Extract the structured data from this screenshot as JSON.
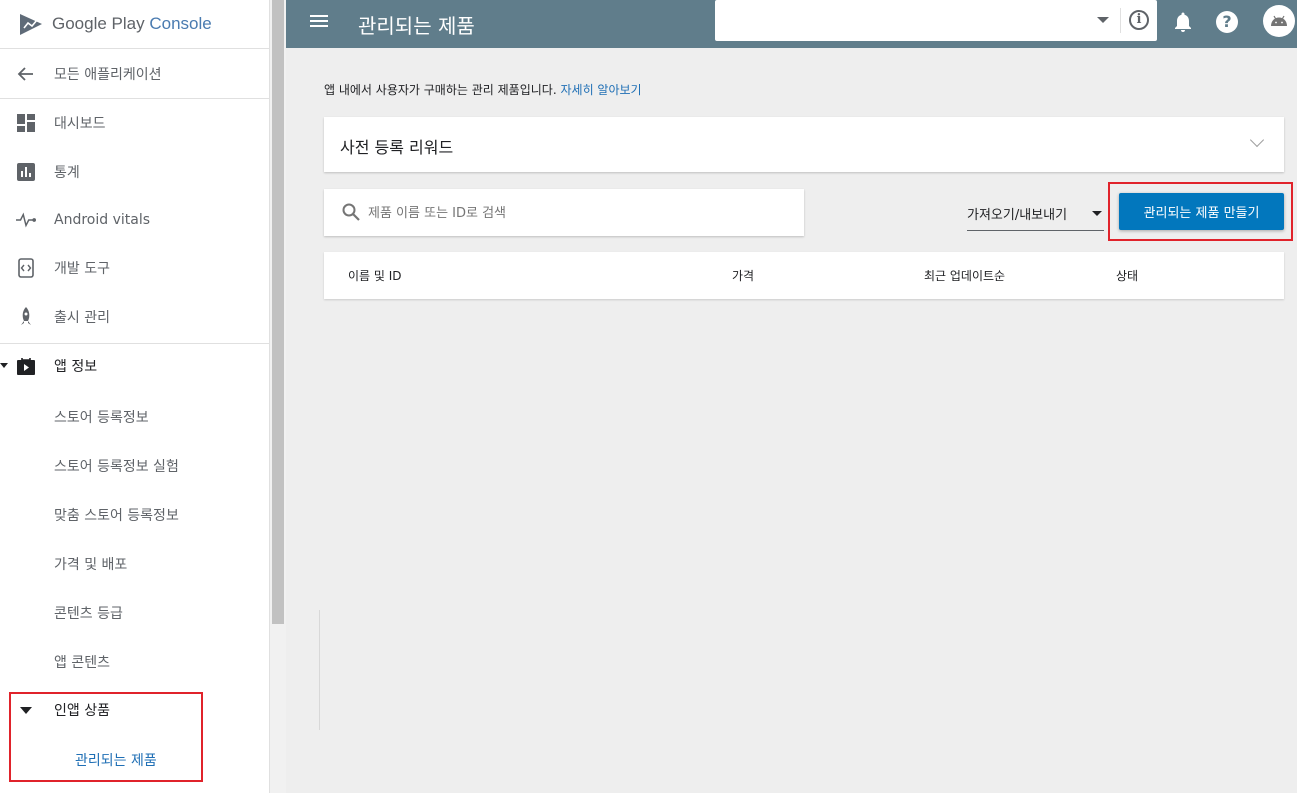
{
  "brand": {
    "name": "Google Play",
    "product": "Console"
  },
  "sidebar": {
    "back_label": "모든 애플리케이션",
    "items": [
      {
        "label": "대시보드",
        "icon": "dashboard-icon"
      },
      {
        "label": "통계",
        "icon": "stats-icon"
      },
      {
        "label": "Android vitals",
        "icon": "vitals-icon"
      },
      {
        "label": "개발 도구",
        "icon": "dev-tools-icon"
      },
      {
        "label": "출시 관리",
        "icon": "rocket-icon"
      }
    ],
    "app_info": {
      "label": "앱 정보",
      "children": [
        "스토어 등록정보",
        "스토어 등록정보 실험",
        "맞춤 스토어 등록정보",
        "가격 및 배포",
        "콘텐츠 등급",
        "앱 콘텐츠"
      ]
    },
    "in_app": {
      "label": "인앱 상품",
      "children": [
        "관리되는 제품"
      ]
    }
  },
  "header": {
    "title": "관리되는 제품",
    "app_select_value": ""
  },
  "main": {
    "intro_text": "앱 내에서 사용자가 구매하는 관리 제품입니다.",
    "learn_more": "자세히 알아보기",
    "collapse_title": "사전 등록 리워드",
    "search_placeholder": "제품 이름 또는 ID로 검색",
    "import_export": "가져오기/내보내기",
    "create_button": "관리되는 제품 만들기",
    "table_headers": [
      "이름 및 ID",
      "가격",
      "최근 업데이트순",
      "상태"
    ]
  },
  "colors": {
    "header_bg": "#607d8b",
    "primary_button": "#0277bd",
    "highlight_box": "#e0232b",
    "link": "#1f6fb5"
  }
}
